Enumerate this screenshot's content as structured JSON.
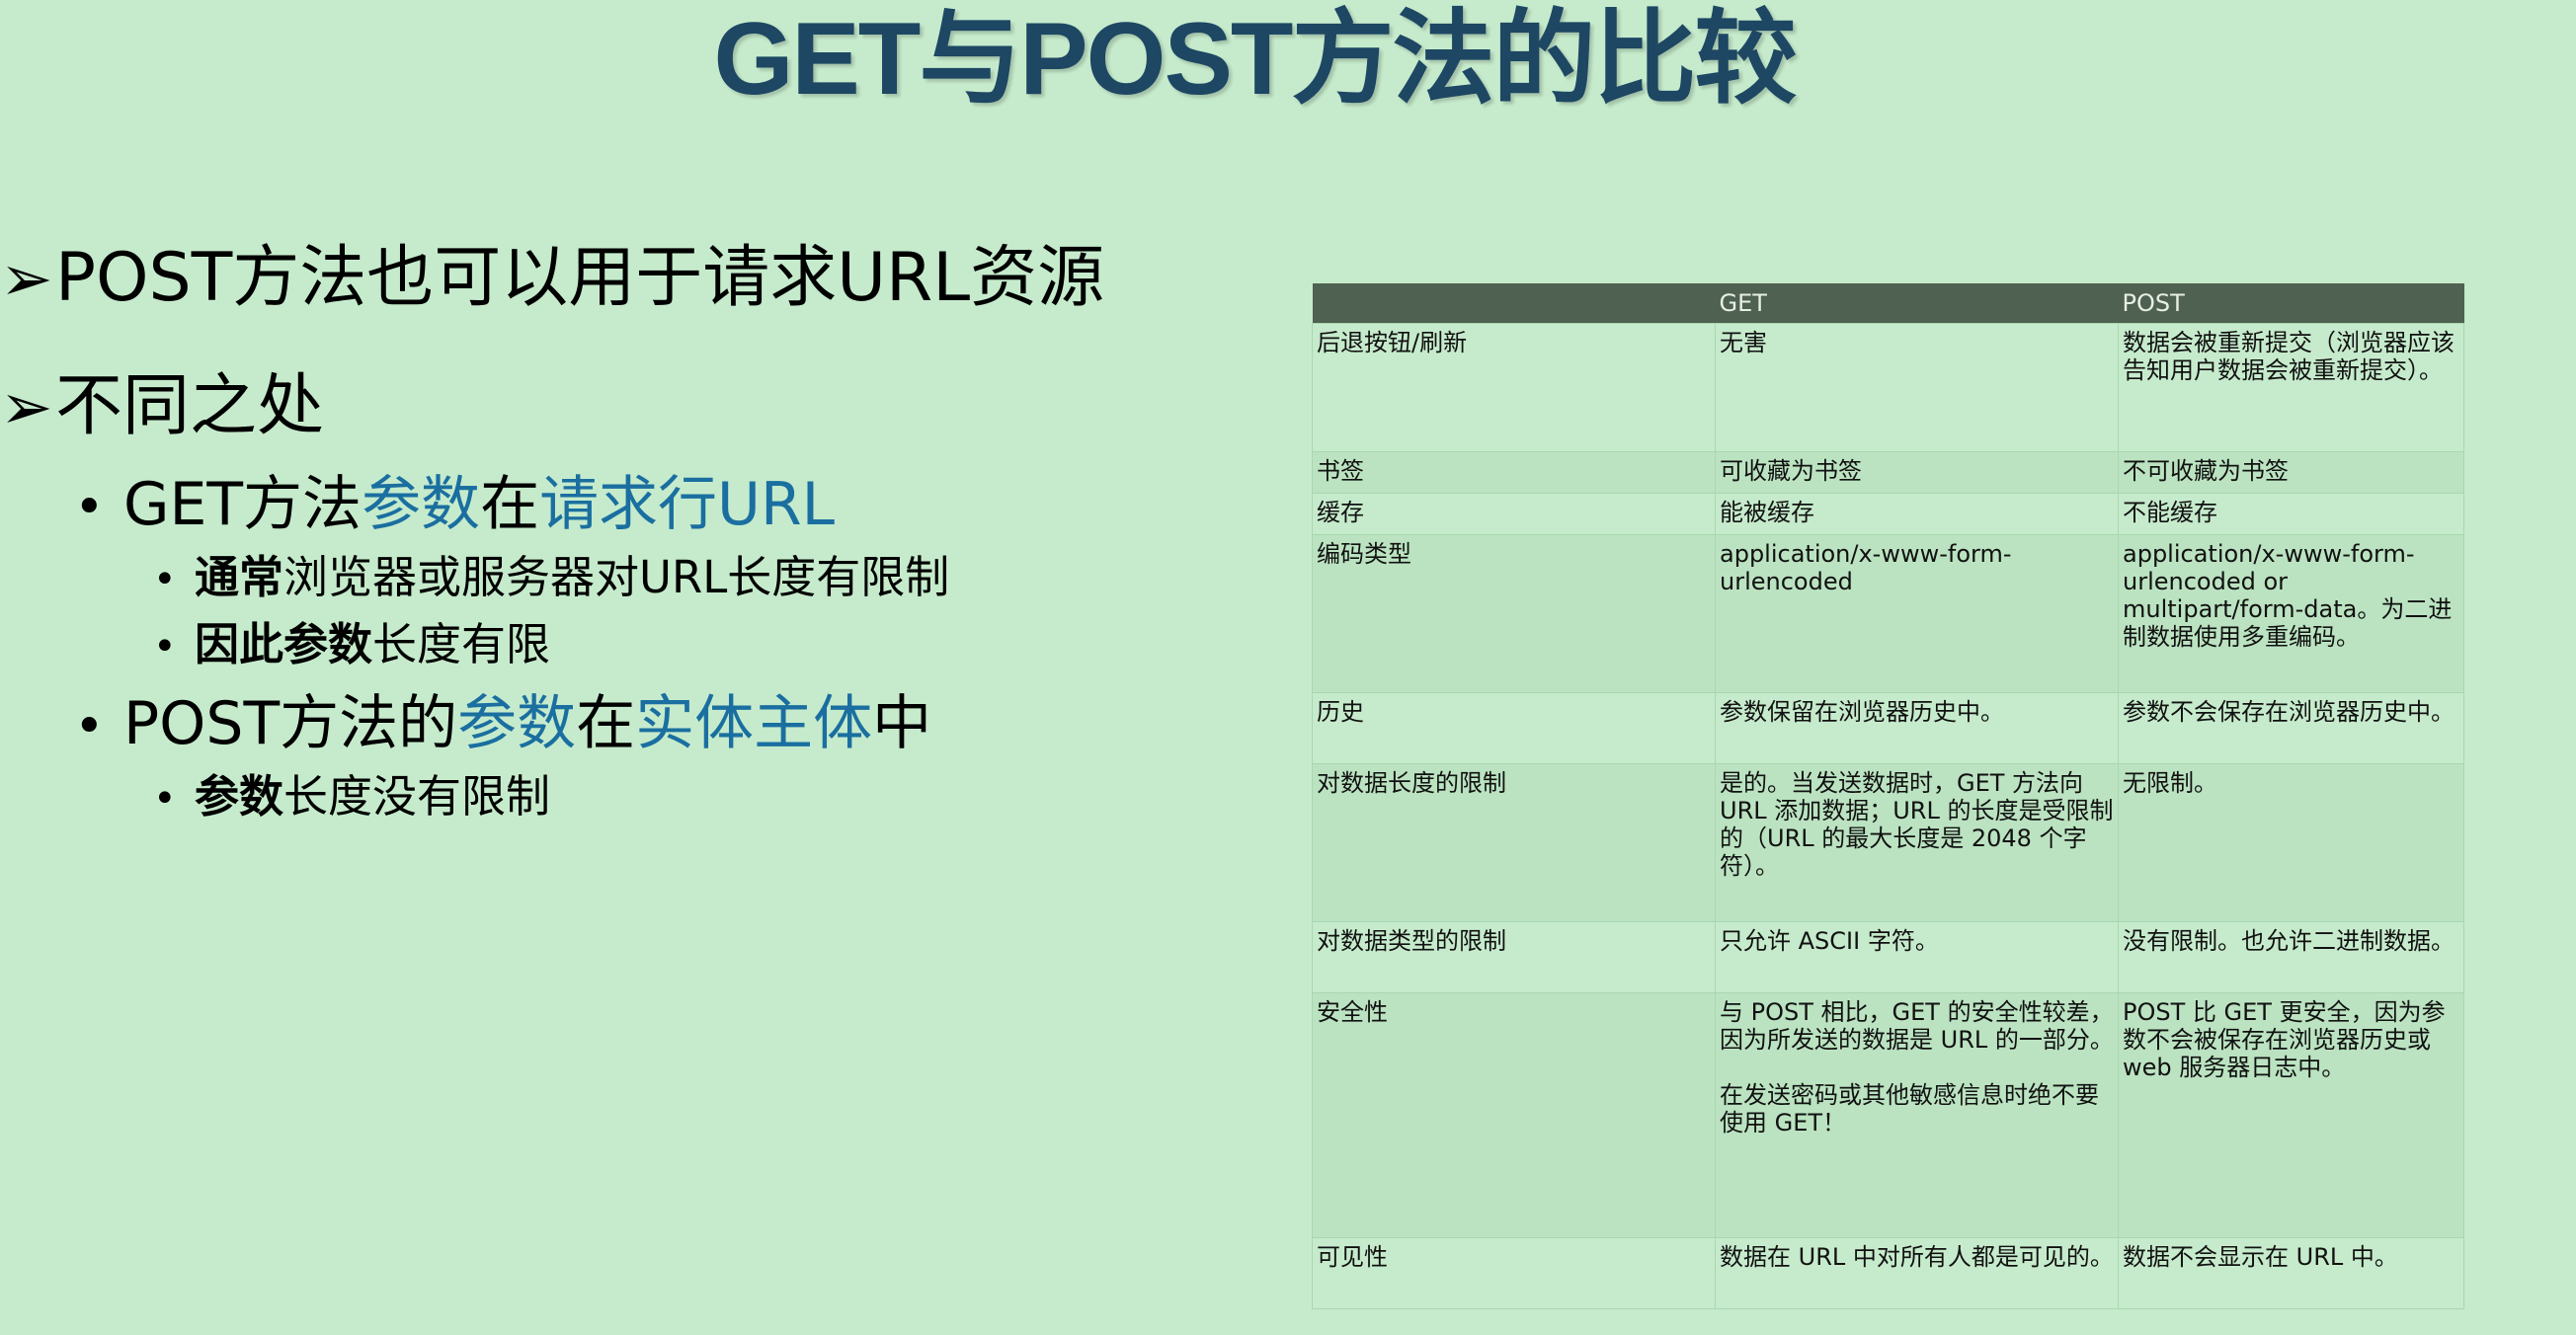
{
  "title": "GET与POST方法的比较",
  "bullets": {
    "b1": "POST方法也可以用于请求URL资源",
    "b2": "不同之处",
    "get_line": {
      "a": "GET方法",
      "b": "参数",
      "c": "在",
      "d": "请求行URL"
    },
    "sub1": {
      "a": "通常",
      "b": "浏览器或服务器对URL长度有限制"
    },
    "sub2": {
      "a": "因此参数",
      "b": "长度有限"
    },
    "post_line": {
      "a": "POST方法的",
      "b": "参数",
      "c": "在",
      "d": "实体主体",
      "e": "中"
    },
    "sub3": {
      "a": "参数",
      "b": "长度没有限制"
    }
  },
  "table": {
    "headers": [
      "",
      "GET",
      "POST"
    ],
    "rows": [
      {
        "feature": "后退按钮/刷新",
        "get": "无害",
        "post": "数据会被重新提交（浏览器应该告知用户数据会被重新提交）。"
      },
      {
        "feature": "书签",
        "get": "可收藏为书签",
        "post": "不可收藏为书签"
      },
      {
        "feature": "缓存",
        "get": "能被缓存",
        "post": "不能缓存"
      },
      {
        "feature": "编码类型",
        "get": "application/x-www-form-urlencoded",
        "post": "application/x-www-form-urlencoded or multipart/form-data。为二进制数据使用多重编码。"
      },
      {
        "feature": "历史",
        "get": "参数保留在浏览器历史中。",
        "post": "参数不会保存在浏览器历史中。"
      },
      {
        "feature": "对数据长度的限制",
        "get": "是的。当发送数据时，GET 方法向 URL 添加数据；URL 的长度是受限制的（URL 的最大长度是 2048 个字符）。",
        "post": "无限制。"
      },
      {
        "feature": "对数据类型的限制",
        "get": "只允许 ASCII 字符。",
        "post": "没有限制。也允许二进制数据。"
      },
      {
        "feature": "安全性",
        "get": "与 POST 相比，GET 的安全性较差，因为所发送的数据是 URL 的一部分。",
        "get_note": "在发送密码或其他敏感信息时绝不要使用 GET！",
        "post": "POST 比 GET 更安全，因为参数不会被保存在浏览器历史或 web 服务器日志中。"
      },
      {
        "feature": "可见性",
        "get": "数据在 URL 中对所有人都是可见的。",
        "post": "数据不会显示在 URL 中。"
      }
    ]
  }
}
